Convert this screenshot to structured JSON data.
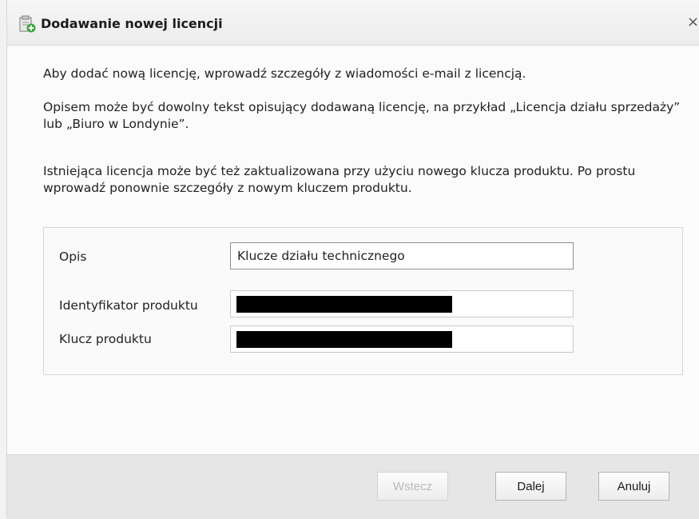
{
  "dialog": {
    "title": "Dodawanie nowej licencji",
    "close_glyph": "×"
  },
  "intro": {
    "p1": "Aby dodać nową licencję, wprowadź szczegóły z wiadomości e-mail z licencją.",
    "p2": "Opisem może być dowolny tekst opisujący dodawaną licencję, na przykład „Licencja działu sprzedaży” lub „Biuro w Londynie”.",
    "p3": "Istniejąca licencja może być też zaktualizowana przy użyciu nowego klucza produktu. Po prostu wprowadź ponownie szczegóły z nowym kluczem produktu."
  },
  "form": {
    "description_label": "Opis",
    "description_value": "Klucze działu technicznego",
    "product_id_label": "Identyfikator produktu",
    "product_key_label": "Klucz produktu"
  },
  "buttons": {
    "back": "Wstecz",
    "next": "Dalej",
    "cancel": "Anuluj"
  },
  "icons": {
    "title": "license-add-icon",
    "close": "close-icon"
  }
}
